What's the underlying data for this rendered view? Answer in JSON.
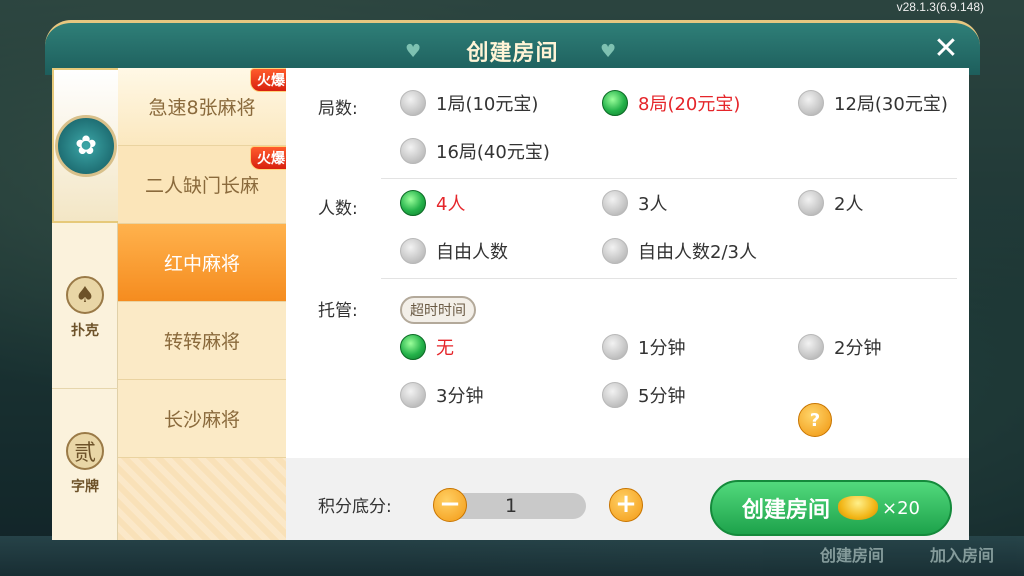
{
  "version": "v28.1.3(6.9.148)",
  "background_menu": [
    "创建房间",
    "加入房间"
  ],
  "dialog": {
    "title": "创建房间",
    "close_icon": "close-icon"
  },
  "categories": [
    {
      "name": "mahjong",
      "label": "",
      "icon": "mahjong-badge-icon"
    },
    {
      "name": "poker",
      "label": "扑克",
      "icon": "spade-icon"
    },
    {
      "name": "zipai",
      "label": "字牌",
      "icon": "zipai-icon"
    }
  ],
  "games": [
    {
      "label": "急速8张麻将",
      "badge": "火爆"
    },
    {
      "label": "二人缺门长麻",
      "badge": "火爆"
    },
    {
      "label": "红中麻将",
      "badge": ""
    },
    {
      "label": "转转麻将",
      "badge": ""
    },
    {
      "label": "长沙麻将",
      "badge": ""
    }
  ],
  "rounds": {
    "label": "局数:",
    "options": [
      "1局(10元宝)",
      "8局(20元宝)",
      "12局(30元宝)",
      "16局(40元宝)"
    ],
    "selected": 1
  },
  "players": {
    "label": "人数:",
    "options": [
      "4人",
      "3人",
      "2人",
      "自由人数",
      "自由人数2/3人"
    ],
    "selected": 0
  },
  "auto": {
    "label": "托管:",
    "tag": "超时时间",
    "options": [
      "无",
      "1分钟",
      "2分钟",
      "3分钟",
      "5分钟"
    ],
    "selected": 0,
    "help": "?"
  },
  "score": {
    "label": "积分底分:",
    "value": "1",
    "minus": "−",
    "plus": "+"
  },
  "create": {
    "label": "创建房间",
    "cost": "×20"
  },
  "colors": {
    "accent": "#1da24b",
    "selected_text": "#e5252a",
    "active_tab": "#f58c1f"
  }
}
